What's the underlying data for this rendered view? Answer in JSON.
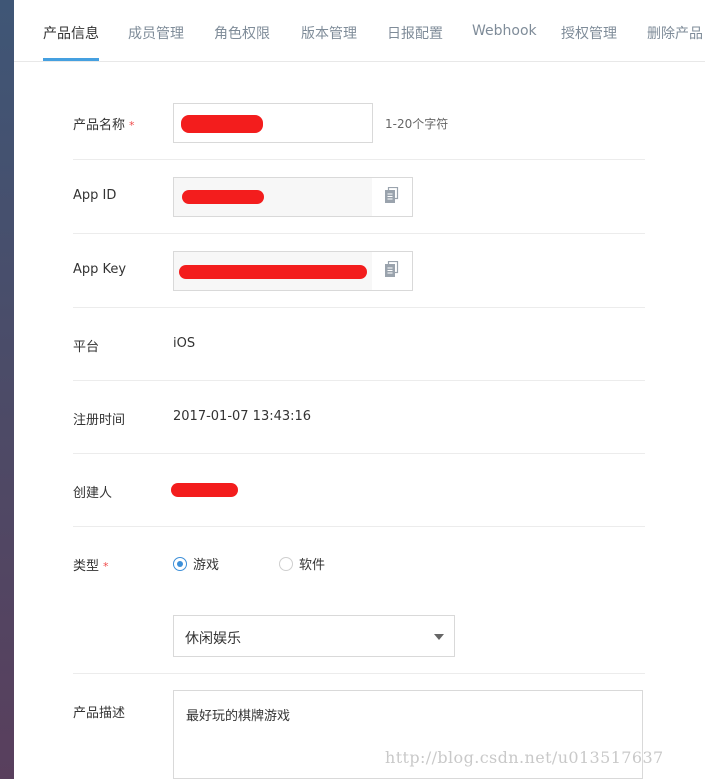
{
  "tabs": [
    {
      "label": "产品信息",
      "active": true
    },
    {
      "label": "成员管理",
      "active": false
    },
    {
      "label": "角色权限",
      "active": false
    },
    {
      "label": "版本管理",
      "active": false
    },
    {
      "label": "日报配置",
      "active": false
    },
    {
      "label": "Webhook",
      "active": false
    },
    {
      "label": "授权管理",
      "active": false
    },
    {
      "label": "删除产品",
      "active": false
    }
  ],
  "form": {
    "required_mark": "*",
    "product_name": {
      "label": "产品名称",
      "hint": "1-20个字符",
      "value_redacted": true
    },
    "app_id": {
      "label": "App ID",
      "value_redacted": true,
      "copy_icon": "copy-icon"
    },
    "app_key": {
      "label": "App Key",
      "value_redacted": true,
      "copy_icon": "copy-icon"
    },
    "platform": {
      "label": "平台",
      "value": "iOS"
    },
    "register_time": {
      "label": "注册时间",
      "value": "2017-01-07 13:43:16"
    },
    "creator": {
      "label": "创建人",
      "value_redacted": true
    },
    "type": {
      "label": "类型",
      "options": [
        {
          "label": "游戏",
          "checked": true
        },
        {
          "label": "软件",
          "checked": false
        }
      ],
      "category_select": "休闲娱乐"
    },
    "description": {
      "label": "产品描述",
      "value": "最好玩的棋牌游戏"
    }
  },
  "watermark": "http://blog.csdn.net/u013517637",
  "colors": {
    "accent": "#45a0e0",
    "redaction": "#f31d1d",
    "required": "#f04a4a"
  }
}
